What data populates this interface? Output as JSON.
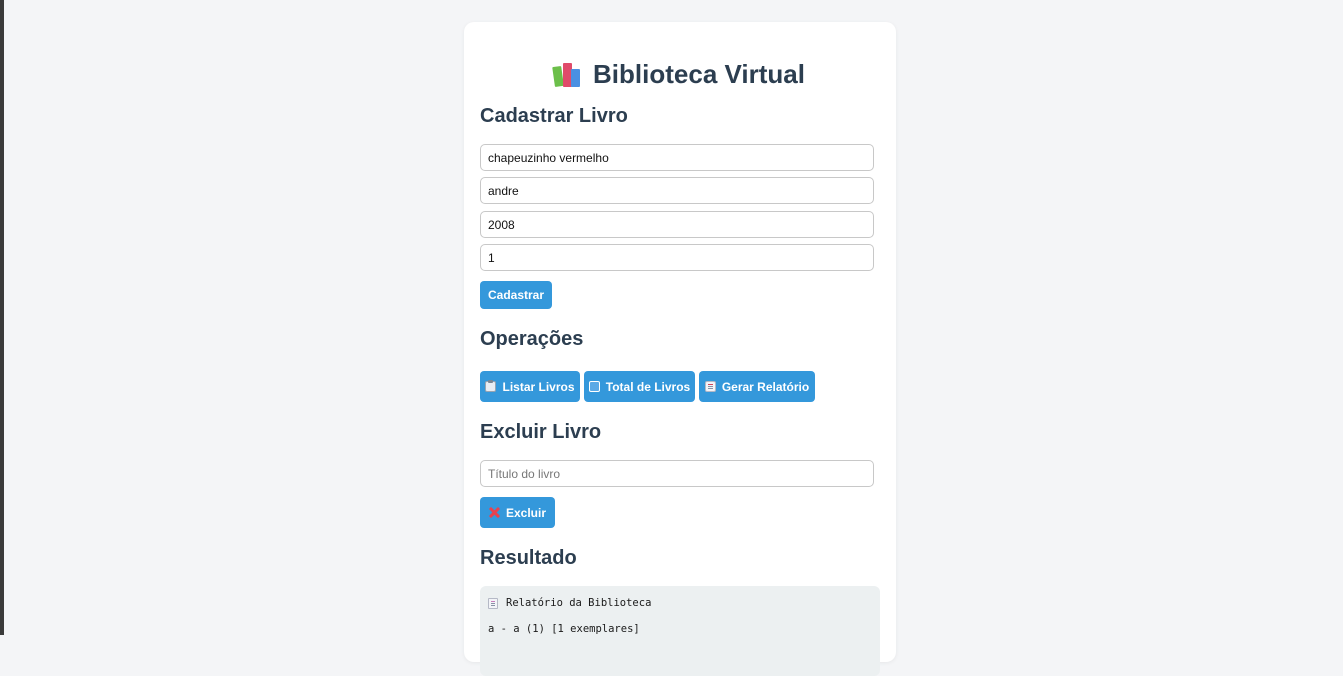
{
  "app": {
    "title": "Biblioteca Virtual",
    "title_icon": "books-icon"
  },
  "register": {
    "heading": "Cadastrar Livro",
    "fields": [
      {
        "name": "title",
        "value": "chapeuzinho vermelho"
      },
      {
        "name": "author",
        "value": "andre"
      },
      {
        "name": "year",
        "value": "2008"
      },
      {
        "name": "copies",
        "value": "1"
      }
    ],
    "submit_label": "Cadastrar"
  },
  "operations": {
    "heading": "Operações",
    "buttons": [
      {
        "label": "Listar Livros",
        "icon": "clipboard-icon"
      },
      {
        "label": "Total de Livros",
        "icon": "numbers-icon"
      },
      {
        "label": "Gerar Relatório",
        "icon": "report-icon"
      }
    ]
  },
  "delete": {
    "heading": "Excluir Livro",
    "placeholder": "Título do livro",
    "value": "",
    "button_label": "Excluir",
    "button_icon": "cross-mark-icon"
  },
  "result": {
    "heading": "Resultado",
    "report_title": "Relatório da Biblioteca",
    "report_icon": "memo-icon",
    "lines": [
      "a - a (1) [1 exemplares]"
    ]
  },
  "colors": {
    "accent": "#3498db",
    "heading": "#2c3e50",
    "background": "#f4f5f7",
    "result_background": "#ecf0f1"
  }
}
